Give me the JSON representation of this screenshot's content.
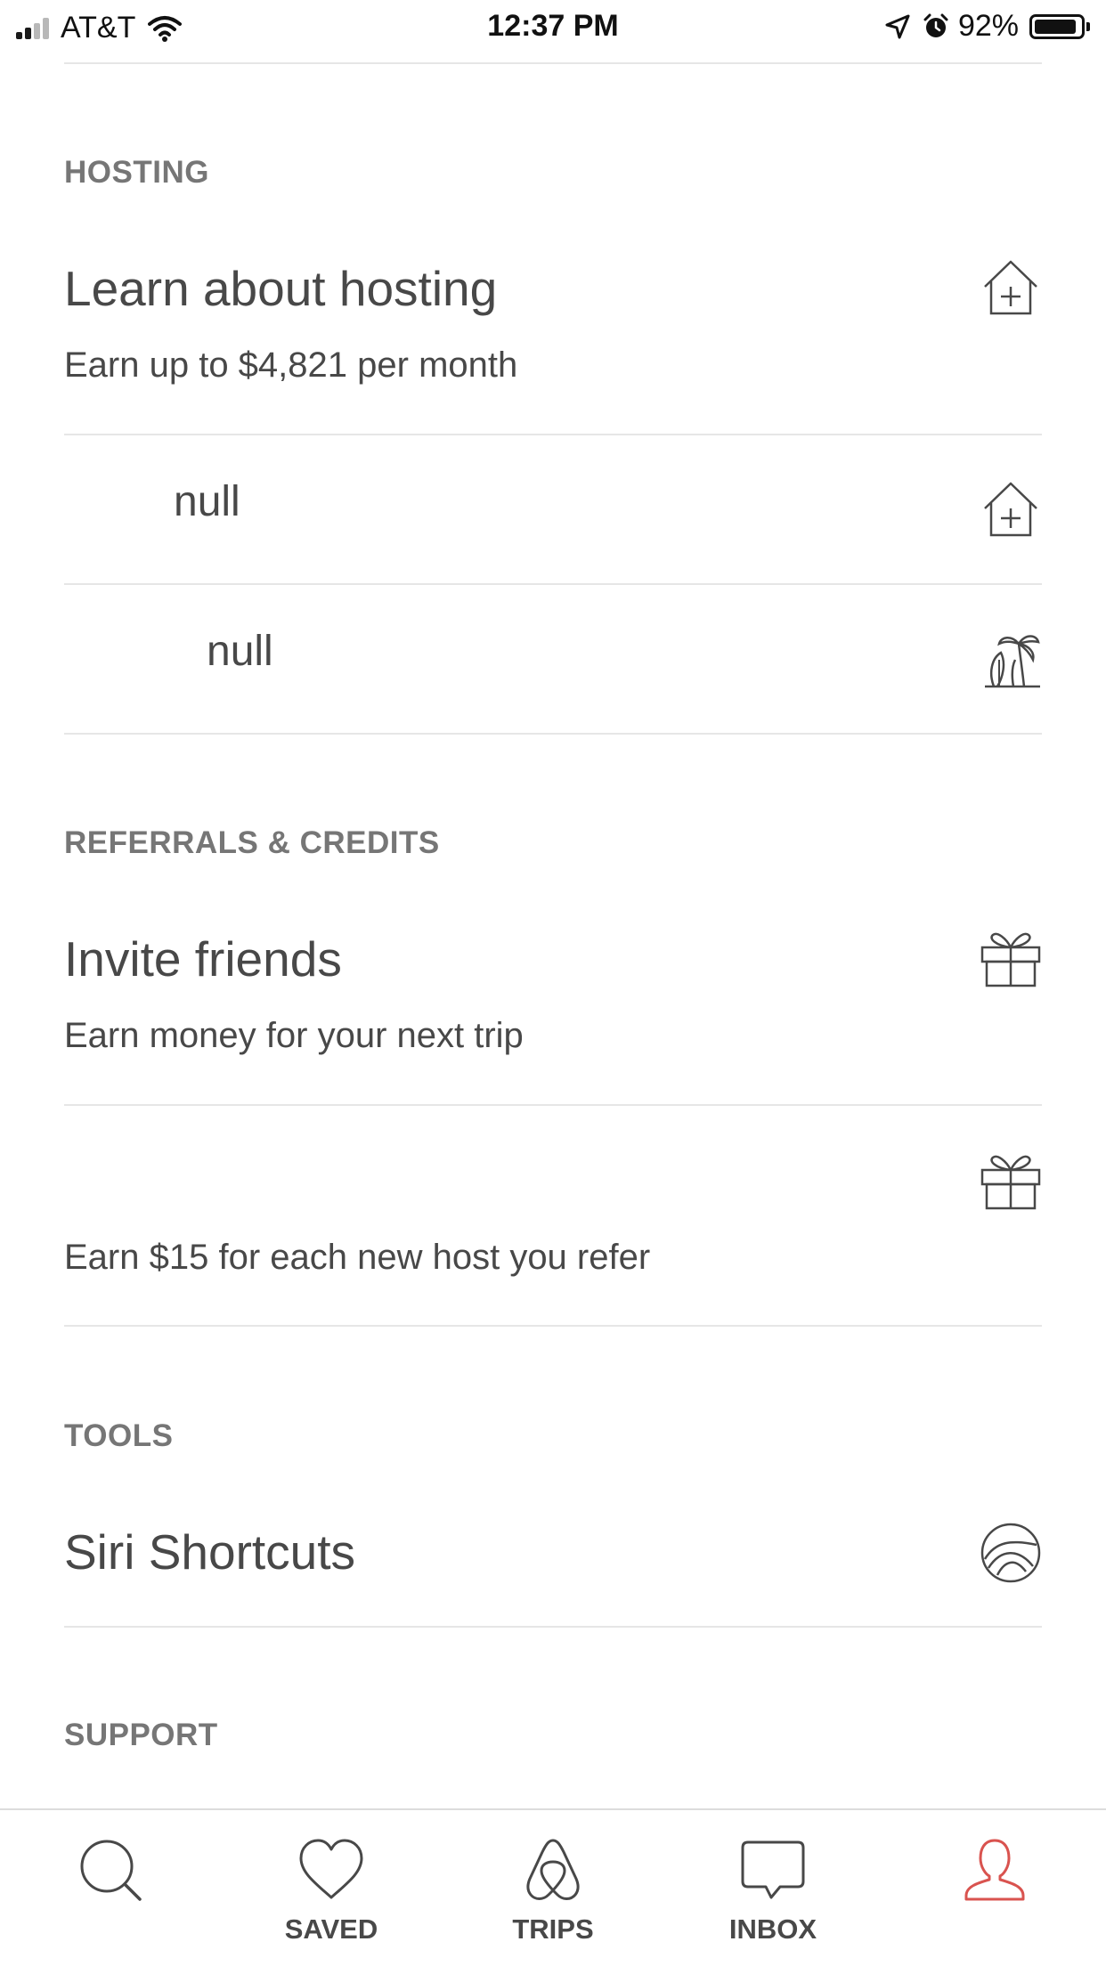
{
  "status_bar": {
    "carrier": "AT&T",
    "time": "12:37 PM",
    "battery": "92%",
    "battery_level": 0.92
  },
  "sections": {
    "hosting": {
      "header": "HOSTING",
      "learn": {
        "title": "Learn about hosting",
        "subtitle": "Earn up to $4,821 per month",
        "icon": "house-plus-icon"
      },
      "null_row_1": {
        "title": "null",
        "icon": "house-plus-icon"
      },
      "null_row_2": {
        "title": "null",
        "icon": "palm-tree-icon"
      }
    },
    "referrals": {
      "header": "REFERRALS & CREDITS",
      "invite": {
        "title": "Invite friends",
        "subtitle": "Earn money for your next trip",
        "icon": "gift-icon"
      },
      "refer_host": {
        "subtitle": "Earn $15 for each new host you refer",
        "icon": "gift-icon"
      }
    },
    "tools": {
      "header": "TOOLS",
      "siri": {
        "title": "Siri Shortcuts",
        "icon": "siri-icon"
      }
    },
    "support": {
      "header": "SUPPORT"
    }
  },
  "tab_bar": {
    "tabs": [
      {
        "label": "",
        "icon": "search-icon"
      },
      {
        "label": "SAVED",
        "icon": "heart-icon"
      },
      {
        "label": "TRIPS",
        "icon": "airbnb-logo-icon"
      },
      {
        "label": "INBOX",
        "icon": "chat-bubble-icon"
      },
      {
        "label": "",
        "icon": "profile-icon"
      }
    ],
    "active_color": "#d9534f",
    "text_color": "#484848"
  }
}
